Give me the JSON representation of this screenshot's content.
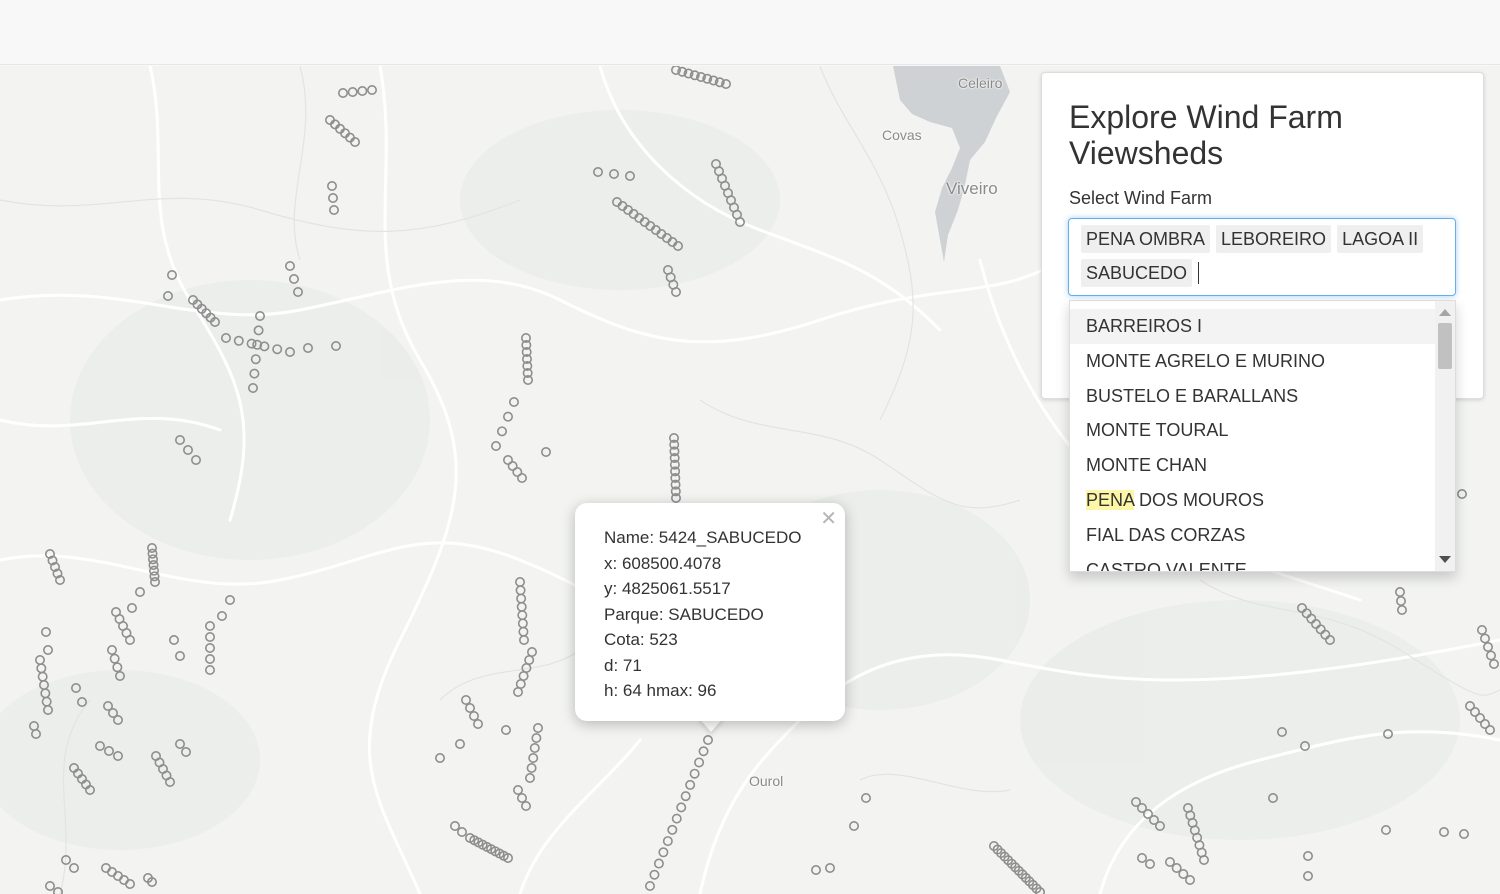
{
  "map": {
    "places": [
      {
        "name": "Celeiro",
        "size": "small"
      },
      {
        "name": "Covas",
        "size": "small"
      },
      {
        "name": "Viveiro",
        "size": "large"
      },
      {
        "name": "Ourol",
        "size": "small"
      }
    ],
    "colors": {
      "land": "#f3f4f2",
      "water": "#cfd2d4",
      "roads": "#ffffff",
      "markers": "#8e8e8e"
    }
  },
  "popup": {
    "close_icon": "close-icon",
    "name": "Name: 5424_SABUCEDO",
    "x": "x: 608500.4078",
    "y": "y: 4825061.5517",
    "parque": "Parque: SABUCEDO",
    "cota": "Cota: 523",
    "d": "d: 71",
    "h": "h: 64 hmax: 96"
  },
  "panel": {
    "title": "Explore Wind Farm Viewsheds",
    "select_label": "Select Wind Farm",
    "selected": [
      "PENA OMBRA",
      "LEBOREIRO",
      "LAGOA II",
      "SABUCEDO"
    ],
    "options": [
      "BARREIROS I",
      "MONTE AGRELO E MURINO",
      "BUSTELO E BARALLANS",
      "MONTE TOURAL",
      "MONTE CHAN",
      "PENA DOS MOUROS",
      "FIAL DAS CORZAS",
      "CASTRO VALENTE"
    ],
    "highlight_text": "PENA",
    "highlight_color": "#fdf6a6"
  }
}
